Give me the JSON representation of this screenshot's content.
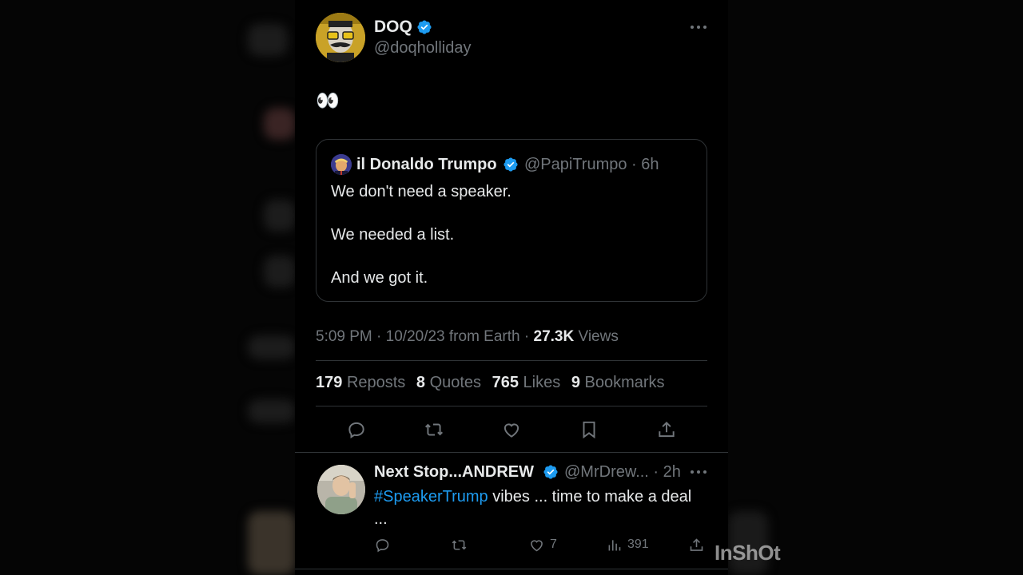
{
  "tweet": {
    "author": {
      "name": "DOQ",
      "handle": "@doqholliday",
      "verified": true
    },
    "text": "👀",
    "quote": {
      "name": "il Donaldo Trumpo",
      "handle": "@PapiTrumpo",
      "age": "6h",
      "lines": [
        "We don't need a speaker.",
        "We needed a list.",
        "And we got it."
      ]
    },
    "meta": {
      "time": "5:09 PM",
      "date": "10/20/23",
      "source": "from Earth",
      "views_count": "27.3K",
      "views_label": "Views"
    },
    "stats": {
      "reposts_count": "179",
      "reposts_label": "Reposts",
      "quotes_count": "8",
      "quotes_label": "Quotes",
      "likes_count": "765",
      "likes_label": "Likes",
      "bookmarks_count": "9",
      "bookmarks_label": "Bookmarks"
    },
    "actions": [
      "reply-icon",
      "repost-icon",
      "like-icon",
      "bookmark-icon",
      "share-icon"
    ]
  },
  "reply": {
    "name": "Next Stop...ANDREW",
    "handle": "@MrDrew...",
    "age": "2h",
    "hashtag": "#SpeakerTrump",
    "text": " vibes ... time to make a deal",
    "text_more": "...",
    "likes": "7",
    "views": "391"
  },
  "watermark": "InShOt",
  "colors": {
    "background": "#000000",
    "text": "#e7e9ea",
    "muted": "#71767b",
    "accent": "#1d9bf0",
    "border": "#2f3336"
  }
}
